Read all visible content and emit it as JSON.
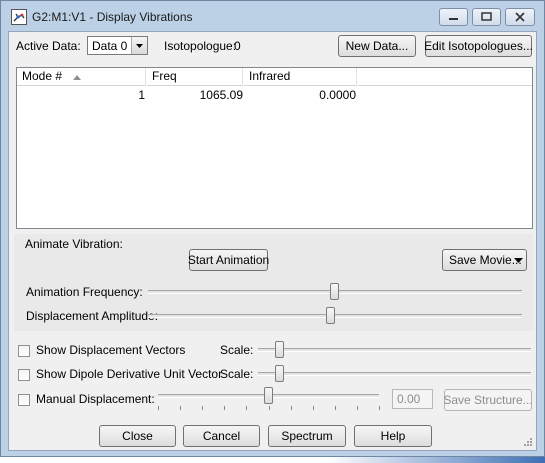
{
  "window": {
    "title": "G2:M1:V1 - Display Vibrations"
  },
  "top": {
    "active_data_label": "Active Data:",
    "active_data_value": "Data 0",
    "isotopologue_label": "Isotopologue:",
    "isotopologue_value": "0",
    "new_data_button": "New Data...",
    "edit_isotopologues_button": "Edit Isotopologues..."
  },
  "table": {
    "columns": [
      "Mode #",
      "Freq",
      "Infrared"
    ],
    "rows": [
      {
        "mode": "1",
        "freq": "1065.09",
        "infrared": "0.0000"
      }
    ]
  },
  "animate": {
    "group_label": "Animate Vibration:",
    "start_button": "Start Animation",
    "save_movie_button": "Save Movie...",
    "frequency_label": "Animation Frequency:",
    "frequency_level": 0.5,
    "amplitude_label": "Displacement Amplitude:",
    "amplitude_level": 0.49
  },
  "options": {
    "show_vectors_label": "Show Displacement Vectors",
    "show_vectors_checked": false,
    "vectors_scale_label": "Scale:",
    "vectors_scale_level": 0.08,
    "show_dipole_label": "Show Dipole Derivative Unit Vector",
    "show_dipole_checked": false,
    "dipole_scale_label": "Scale:",
    "dipole_scale_level": 0.08,
    "manual_label": "Manual Displacement:",
    "manual_checked": false,
    "manual_level": 0.5,
    "manual_value": "0.00",
    "save_structure_button": "Save Structure..."
  },
  "footer": {
    "close": "Close",
    "cancel": "Cancel",
    "spectrum": "Spectrum",
    "help": "Help"
  },
  "colors": {
    "frame": "#bcd1e6",
    "client": "#f0f0f0",
    "close_button_hover": "#d9534f"
  }
}
